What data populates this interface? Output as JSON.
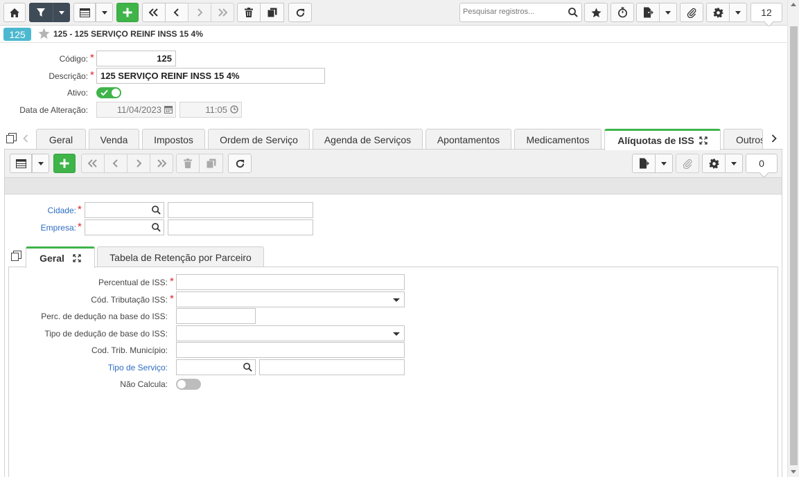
{
  "toolbar": {
    "search_placeholder": "Pesquisar registros...",
    "record_count": "12",
    "icons": [
      "home-icon",
      "filter-icon",
      "grid-view-icon",
      "add-icon",
      "first-icon",
      "previous-icon",
      "next-icon",
      "last-icon",
      "delete-icon",
      "copy-icon",
      "refresh-icon",
      "search-icon",
      "favorite-icon",
      "timer-icon",
      "export-icon",
      "attach-icon",
      "gear-icon"
    ]
  },
  "record": {
    "id_badge": "125",
    "title": "125 - 125 SERVIÇO REINF INSS 15 4%"
  },
  "header_form": {
    "codigo_label": "Código:",
    "codigo_value": "125",
    "descricao_label": "Descrição:",
    "descricao_value": "125 SERVIÇO REINF INSS 15 4%",
    "ativo_label": "Ativo:",
    "ativo_on": true,
    "data_alteracao_label": "Data de Alteração:",
    "data_value": "11/04/2023",
    "hora_value": "11:05"
  },
  "main_tabs": [
    {
      "label": "Geral"
    },
    {
      "label": "Venda"
    },
    {
      "label": "Impostos"
    },
    {
      "label": "Ordem de Serviço"
    },
    {
      "label": "Agenda de Serviços"
    },
    {
      "label": "Apontamentos"
    },
    {
      "label": "Medicamentos"
    },
    {
      "label": "Alíquotas de ISS",
      "active": true
    },
    {
      "label": "Outros"
    }
  ],
  "sub_toolbar": {
    "record_count": "0"
  },
  "sub_form": {
    "cidade_label": "Cidade:",
    "empresa_label": "Empresa:"
  },
  "inner_tabs": [
    {
      "label": "Geral",
      "active": true
    },
    {
      "label": "Tabela de Retenção por Parceiro"
    }
  ],
  "detail_form": {
    "percentual_iss_label": "Percentual de ISS:",
    "cod_tributacao_label": "Cód. Tributação ISS:",
    "perc_deducao_label": "Perc. de dedução na base do ISS:",
    "tipo_deducao_label": "Tipo de dedução de base do ISS:",
    "cod_trib_municipio_label": "Cod. Trib. Município:",
    "tipo_servico_label": "Tipo de Serviço:",
    "nao_calcula_label": "Não Calcula:",
    "nao_calcula_on": false
  },
  "colors": {
    "accent_green": "#3fb449",
    "badge_blue": "#4cb8cf",
    "toolbar_dark": "#3f4b57",
    "link_blue": "#2b6cc4",
    "required_red": "#d9262b"
  }
}
